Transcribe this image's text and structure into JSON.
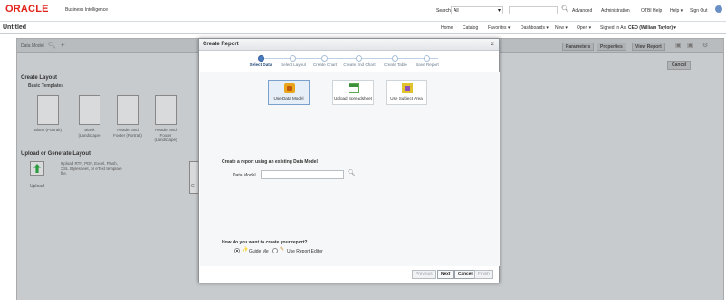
{
  "branding": {
    "logo": "ORACLE",
    "product": "Business Intelligence"
  },
  "top_bar": {
    "search_label": "Search",
    "search_scope": "All",
    "links": [
      "Advanced",
      "Administration",
      "OTBI Help",
      "Help ▾",
      "Sign Out"
    ],
    "user_icon": "user-icon"
  },
  "sub_bar": {
    "page_title": "Untitled",
    "nav": [
      "Home",
      "Catalog",
      "Favorites ▾",
      "Dashboards ▾",
      "New ▾",
      "Open ▾",
      "Signed In As",
      "CEO (William Taylor) ▾"
    ]
  },
  "background": {
    "data_model_label": "Data Model",
    "toolbar_buttons": [
      "Parameters",
      "Properties",
      "View Report"
    ],
    "cancel_label": "Cancel",
    "create_layout_title": "Create Layout",
    "basic_templates_label": "Basic Templates",
    "templates": [
      "Blank (Portrait)",
      "Blank (Landscape)",
      "Header and Footer (Portrait)",
      "Header and Footer (Landscape)"
    ],
    "upload_section_title": "Upload or Generate Layout",
    "upload_description": "Upload RTF, PDF, Excel, Flash, XSL Stylesheet, or eText template file.",
    "upload_label": "Upload",
    "generate_label": "G"
  },
  "dialog": {
    "title": "Create Report",
    "close": "×",
    "steps": [
      {
        "label": "Select Data",
        "active": true
      },
      {
        "label": "Select Layout",
        "active": false
      },
      {
        "label": "Create Chart",
        "active": false
      },
      {
        "label": "Create 2nd Chart",
        "active": false
      },
      {
        "label": "Create Table",
        "active": false
      },
      {
        "label": "Save Report",
        "active": false
      }
    ],
    "options": [
      {
        "label": "Use Data Model",
        "icon": "data-model-icon",
        "selected": true
      },
      {
        "label": "Upload Spreadsheet",
        "icon": "spreadsheet-icon",
        "selected": false
      },
      {
        "label": "Use Subject Area",
        "icon": "subject-area-icon",
        "selected": false
      }
    ],
    "existing_text": "Create a report using an existing Data Model",
    "data_model_field_label": "Data Model",
    "data_model_value": "",
    "how_text": "How do you want to create your report?",
    "modes": [
      {
        "label": "Guide Me",
        "icon": "wand-icon",
        "selected": true
      },
      {
        "label": "Use Report Editor",
        "icon": "pencil-icon",
        "selected": false
      }
    ],
    "footer_buttons": [
      {
        "label": "Previous",
        "enabled": false
      },
      {
        "label": "Next",
        "enabled": true
      },
      {
        "label": "Cancel",
        "enabled": true
      },
      {
        "label": "Finish",
        "enabled": false
      }
    ]
  }
}
